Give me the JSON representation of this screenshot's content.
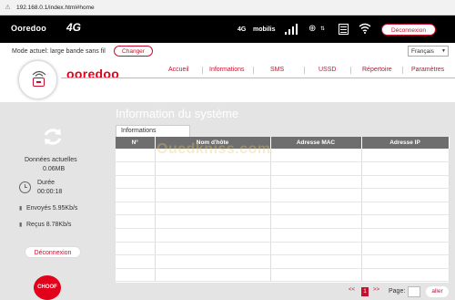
{
  "browser": {
    "url": "192.168.0.1/index.html#home"
  },
  "topbar": {
    "brand": "Ooredoo",
    "brand_suffix": "4G",
    "network_type": "4G",
    "operator": "mobilis",
    "logout_label": "Déconnexion"
  },
  "header": {
    "mode_label": "Mode actuel:",
    "mode_value": "large bande sans fil",
    "change_label": "Changer",
    "language": "Français",
    "wordmark": "ooredoo"
  },
  "nav": {
    "items": [
      {
        "label": "Accueil"
      },
      {
        "label": "Informations"
      },
      {
        "label": "SMS"
      },
      {
        "label": "USSD"
      },
      {
        "label": "Répertoire"
      },
      {
        "label": "Paramètres"
      }
    ]
  },
  "sidebar": {
    "data_label": "Données actuelles",
    "data_value": "0.06MB",
    "duration_label": "Durée",
    "duration_value": "00:00:18",
    "sent": "Envoyés 5.95Kb/s",
    "received": "Reçus 8.78Kb/s",
    "logout_label": "Déconnexion",
    "chat_label": "CHOOF"
  },
  "main": {
    "title": "Information du système",
    "tab": "Informations",
    "columns": [
      "N°",
      "Nom d'hôte",
      "Adresse MAC",
      "Adresse IP"
    ],
    "watermark": "Ouedkniss.com"
  },
  "pager": {
    "prev": "<<",
    "current": "1",
    "next": ">>",
    "page_label": "Page:",
    "go_label": "aller"
  },
  "colors": {
    "accent": "#c8102e",
    "brand_red": "#e2001a",
    "topbar": "#000000",
    "background": "#e4e4e4",
    "table_header": "#6e6e6e"
  },
  "icons": [
    "warning-icon",
    "signal-icon",
    "globe-icon",
    "sim-icon",
    "wifi-icon",
    "refresh-icon",
    "clock-icon",
    "upload-icon",
    "download-icon"
  ]
}
